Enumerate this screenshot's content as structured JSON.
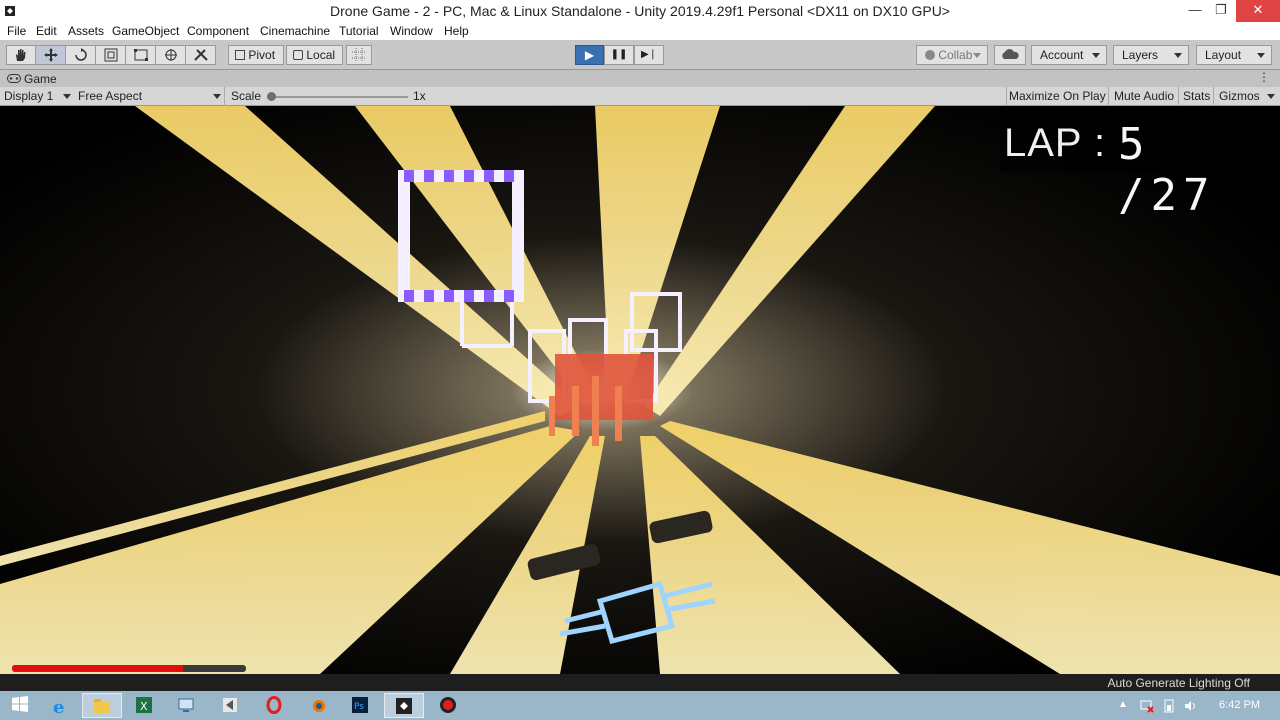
{
  "window": {
    "title": "Drone Game - 2 - PC, Mac & Linux Standalone - Unity 2019.4.29f1 Personal <DX11 on DX10 GPU>",
    "controls": {
      "minimize": "—",
      "maximize": "❐",
      "close": "✕"
    }
  },
  "menu": [
    "File",
    "Edit",
    "Assets",
    "GameObject",
    "Component",
    "Cinemachine",
    "Tutorial",
    "Window",
    "Help"
  ],
  "toolbar": {
    "tools": [
      "hand-tool",
      "move-tool",
      "rotate-tool",
      "scale-tool",
      "rect-tool",
      "transform-tool",
      "custom-tool"
    ],
    "pivot_label": "Pivot",
    "local_label": "Local",
    "play_label": "▶",
    "pause_label": "❚❚",
    "step_label": "▶❘",
    "collab_label": "Collab",
    "account_label": "Account",
    "layers_label": "Layers",
    "layout_label": "Layout"
  },
  "game_view": {
    "tab_label": "Game",
    "display": "Display 1",
    "aspect": "Free Aspect",
    "scale_label": "Scale",
    "scale_value": "1x",
    "maximize_on_play": "Maximize On Play",
    "mute_audio": "Mute Audio",
    "stats": "Stats",
    "gizmos": "Gizmos"
  },
  "hud": {
    "lap_label": "LAP :",
    "lap_value": "5 /27",
    "health_fraction": 0.73,
    "health_color": "#e30d0d"
  },
  "status": {
    "lighting": "Auto Generate Lighting Off"
  },
  "taskbar": {
    "apps": [
      "start-icon",
      "internet-explorer-icon",
      "file-explorer-icon",
      "excel-icon",
      "remote-desktop-icon",
      "visual-studio-icon",
      "opera-icon",
      "blender-icon",
      "photoshop-icon",
      "unity-icon",
      "record-icon"
    ],
    "clock": "6:42 PM"
  },
  "colors": {
    "play_active": "#3a6fb0",
    "beam_yellow": "#f7e39a",
    "gate_white": "#f4f0ff",
    "gate_purple": "#8a5cff",
    "drone_cyan": "#9fd4ff"
  }
}
